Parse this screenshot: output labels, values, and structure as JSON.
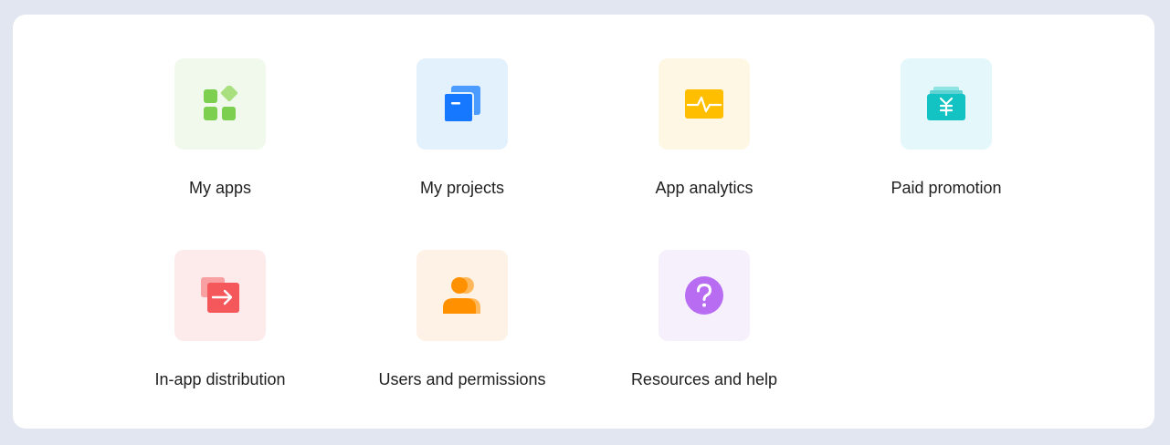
{
  "tiles": [
    {
      "label": "My apps",
      "icon": "apps-grid-icon",
      "bg": "#f1f8ec",
      "accent": "#7ccf4f"
    },
    {
      "label": "My projects",
      "icon": "projects-icon",
      "bg": "#e3f1fd",
      "accent": "#1677ff"
    },
    {
      "label": "App analytics",
      "icon": "analytics-icon",
      "bg": "#fdf7e4",
      "accent": "#ffbf00"
    },
    {
      "label": "Paid promotion",
      "icon": "promotion-icon",
      "bg": "#e4f7fa",
      "accent": "#13c2c2"
    },
    {
      "label": "In-app distribution",
      "icon": "distribution-icon",
      "bg": "#fdebec",
      "accent": "#f5585b"
    },
    {
      "label": "Users and permissions",
      "icon": "users-icon",
      "bg": "#fdf2e5",
      "accent": "#ff9100"
    },
    {
      "label": "Resources and help",
      "icon": "help-icon",
      "bg": "#f6f0fd",
      "accent": "#b76cf2"
    }
  ]
}
